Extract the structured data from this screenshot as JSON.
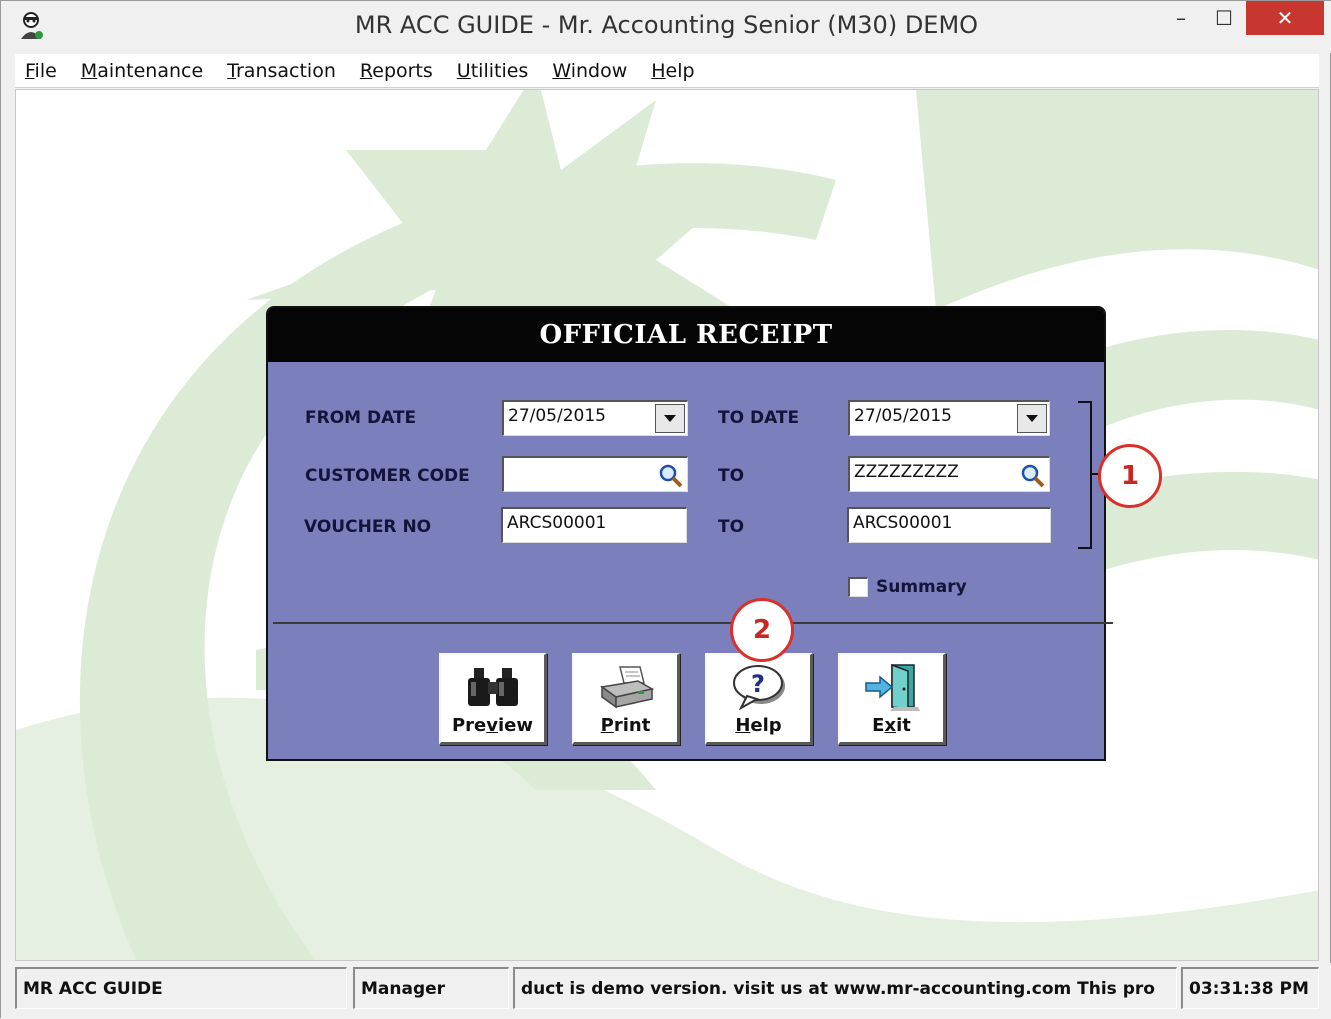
{
  "window": {
    "title": "MR ACC GUIDE - Mr. Accounting Senior (M30) DEMO",
    "controls": {
      "minimize": "–",
      "maximize": "☐",
      "close": "✕"
    }
  },
  "menu": [
    {
      "ul": "F",
      "rest": "ile"
    },
    {
      "ul": "M",
      "rest": "aintenance"
    },
    {
      "ul": "T",
      "rest": "ransaction"
    },
    {
      "ul": "R",
      "rest": "eports"
    },
    {
      "ul": "U",
      "rest": "tilities"
    },
    {
      "ul": "W",
      "rest": "indow"
    },
    {
      "ul": "H",
      "rest": "elp"
    }
  ],
  "dialog": {
    "title": "OFFICIAL RECEIPT",
    "from_date_label": "FROM DATE",
    "from_date_value": "27/05/2015",
    "to_date_label": "TO DATE",
    "to_date_value": "27/05/2015",
    "customer_code_label": "CUSTOMER CODE",
    "customer_code_from": "",
    "customer_code_to_label": "TO",
    "customer_code_to": "ZZZZZZZZZ",
    "voucher_no_label": "VOUCHER NO",
    "voucher_no_from": "ARCS00001",
    "voucher_no_to_label": "TO",
    "voucher_no_to": "ARCS00001",
    "summary_label": "Summary",
    "summary_checked": false,
    "buttons": {
      "preview": {
        "a": "Pre",
        "u": "v",
        "b": "iew"
      },
      "print": {
        "a": "",
        "u": "P",
        "b": "rint"
      },
      "help": {
        "a": "",
        "u": "H",
        "b": "elp"
      },
      "exit": {
        "a": "E",
        "u": "x",
        "b": "it"
      }
    }
  },
  "annotations": {
    "marker1": "1",
    "marker2": "2",
    "color": "#d9302a"
  },
  "statusbar": {
    "company": "MR ACC GUIDE",
    "user": "Manager",
    "message": "duct is demo version.  visit us at www.mr-accounting.com This pro",
    "time": "03:31:38 PM"
  },
  "colors": {
    "dialog_bg": "#7b80bd",
    "header_bg": "#050505",
    "art_green": "#dcebd6"
  }
}
